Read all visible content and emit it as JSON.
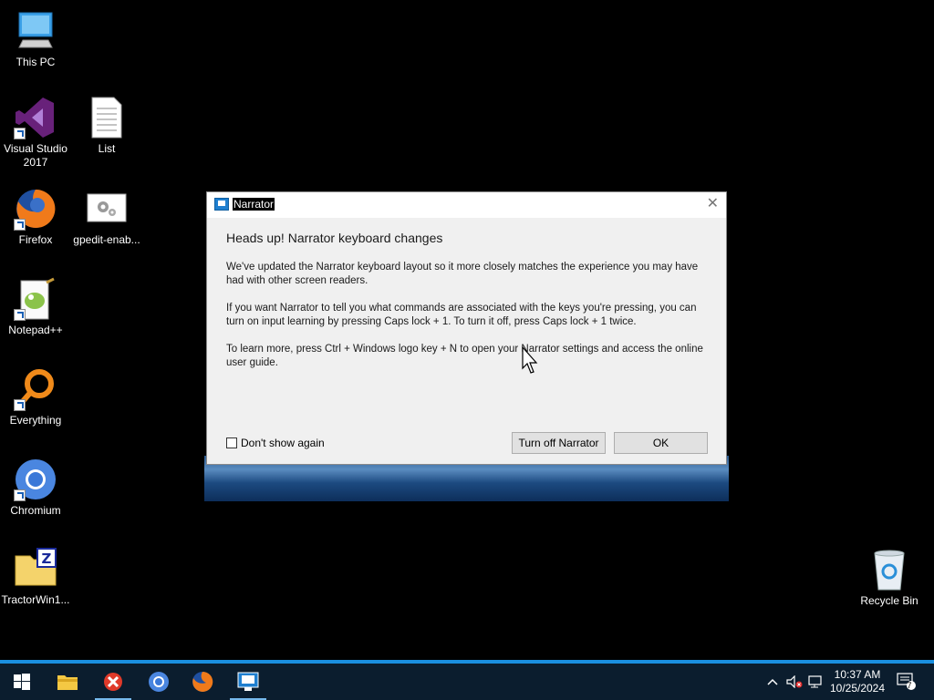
{
  "desktop": {
    "icons": [
      {
        "label": "This PC"
      },
      {
        "label": "Visual Studio\n2017"
      },
      {
        "label": "List"
      },
      {
        "label": "Firefox"
      },
      {
        "label": "gpedit-enab..."
      },
      {
        "label": "Notepad++"
      },
      {
        "label": "Everything"
      },
      {
        "label": "Chromium"
      },
      {
        "label": "TractorWin1..."
      },
      {
        "label": "Recycle Bin"
      }
    ]
  },
  "dialog": {
    "title": "Narrator",
    "heading": "Heads up! Narrator keyboard changes",
    "paragraphs": [
      "We've updated the Narrator keyboard layout so it more closely matches the experience you may have had with other screen readers.",
      "If you want Narrator to tell you what commands are associated with the keys you're pressing, you can turn on input learning by pressing Caps lock + 1. To turn it off, press Caps lock + 1 twice.",
      "To learn more, press Ctrl + Windows logo key + N to open your Narrator settings and access the online user guide."
    ],
    "checkbox_label": "Don't show again",
    "checkbox_checked": false,
    "turn_off_label": "Turn off Narrator",
    "ok_label": "OK",
    "close_glyph": "✕"
  },
  "taskbar": {
    "apps": [
      "file-explorer-icon",
      "tractor-icon",
      "chromium-icon",
      "firefox-icon",
      "narrator-icon"
    ],
    "time": "10:37 AM",
    "date": "10/25/2024",
    "notification_count": "7"
  },
  "colors": {
    "taskbar_bg": "#0b1d2e",
    "accent": "#1a8fe0"
  }
}
